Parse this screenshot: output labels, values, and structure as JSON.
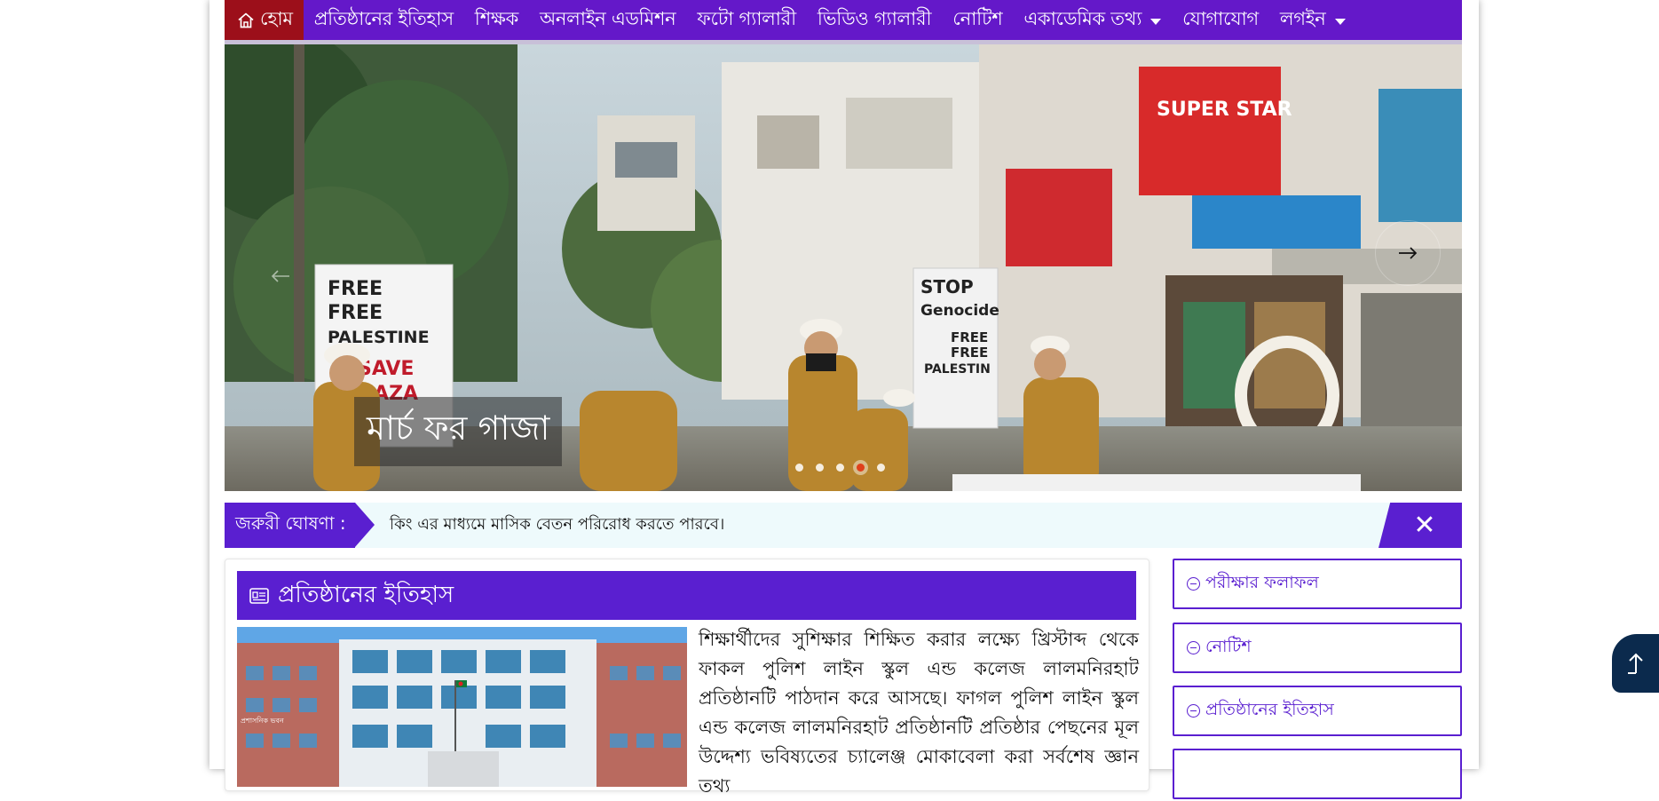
{
  "nav": {
    "items": [
      {
        "label": "হোম",
        "icon": "home-icon",
        "active": true
      },
      {
        "label": "প্রতিষ্ঠানের ইতিহাস"
      },
      {
        "label": "শিক্ষক"
      },
      {
        "label": "অনলাইন এডমিশন"
      },
      {
        "label": "ফটো গ্যালারী"
      },
      {
        "label": "ভিডিও গ্যালারী"
      },
      {
        "label": "নোটিশ"
      },
      {
        "label": "একাডেমিক তথ্য",
        "dropdown": true
      },
      {
        "label": "যোগাযোগ"
      },
      {
        "label": "লগইন",
        "dropdown": true
      }
    ]
  },
  "slider": {
    "caption": "মার্চ ফর গাজা",
    "signs": {
      "left": [
        "FREE",
        "FREE",
        "PALESTINE",
        "SAVE",
        "GAZA"
      ],
      "right": [
        "STOP",
        "Genocide",
        "FREE",
        "FREE",
        "PALESTIN"
      ],
      "store": "SUPER STAR"
    },
    "dot_count": 5,
    "active_dot": 4
  },
  "ticker": {
    "label": "জরুরী ঘোষণা :",
    "text": "কিং এর মাধ্যমে মাসিক বেতন পরিরোধ করতে পারবে।",
    "close": "✕"
  },
  "history": {
    "title": "প্রতিষ্ঠানের ইতিহাস",
    "text": "শিক্ষার্থীদের সুশিক্ষার শিক্ষিত করার লক্ষ্যে খ্রিস্টাব্দ থেকে ফাকল পুলিশ লাইন স্কুল এন্ড কলেজ লালমনিরহাট প্রতিষ্ঠানটি পাঠদান করে আসছে। ফাগল পুলিশ লাইন স্কুল এন্ড কলেজ লালমনিরহাট প্রতিষ্ঠানটি প্রতিষ্ঠার পেছনের মূল উদ্দেশ্য ভবিষ্যতের চ্যালেঞ্জ মোকাবেলা করা সর্বশেষ জ্ঞান তথ্য",
    "building_sign": "প্রশাসনিক ভবন"
  },
  "sidebar": {
    "items": [
      {
        "label": "পরীক্ষার ফলাফল"
      },
      {
        "label": "নোটিশ"
      },
      {
        "label": "প্রতিষ্ঠানের ইতিহাস"
      }
    ]
  },
  "colors": {
    "nav": "#6418c9",
    "home_active": "#9c0f1a",
    "accent": "#5a1fd0",
    "to_top": "#0b2a4d"
  }
}
